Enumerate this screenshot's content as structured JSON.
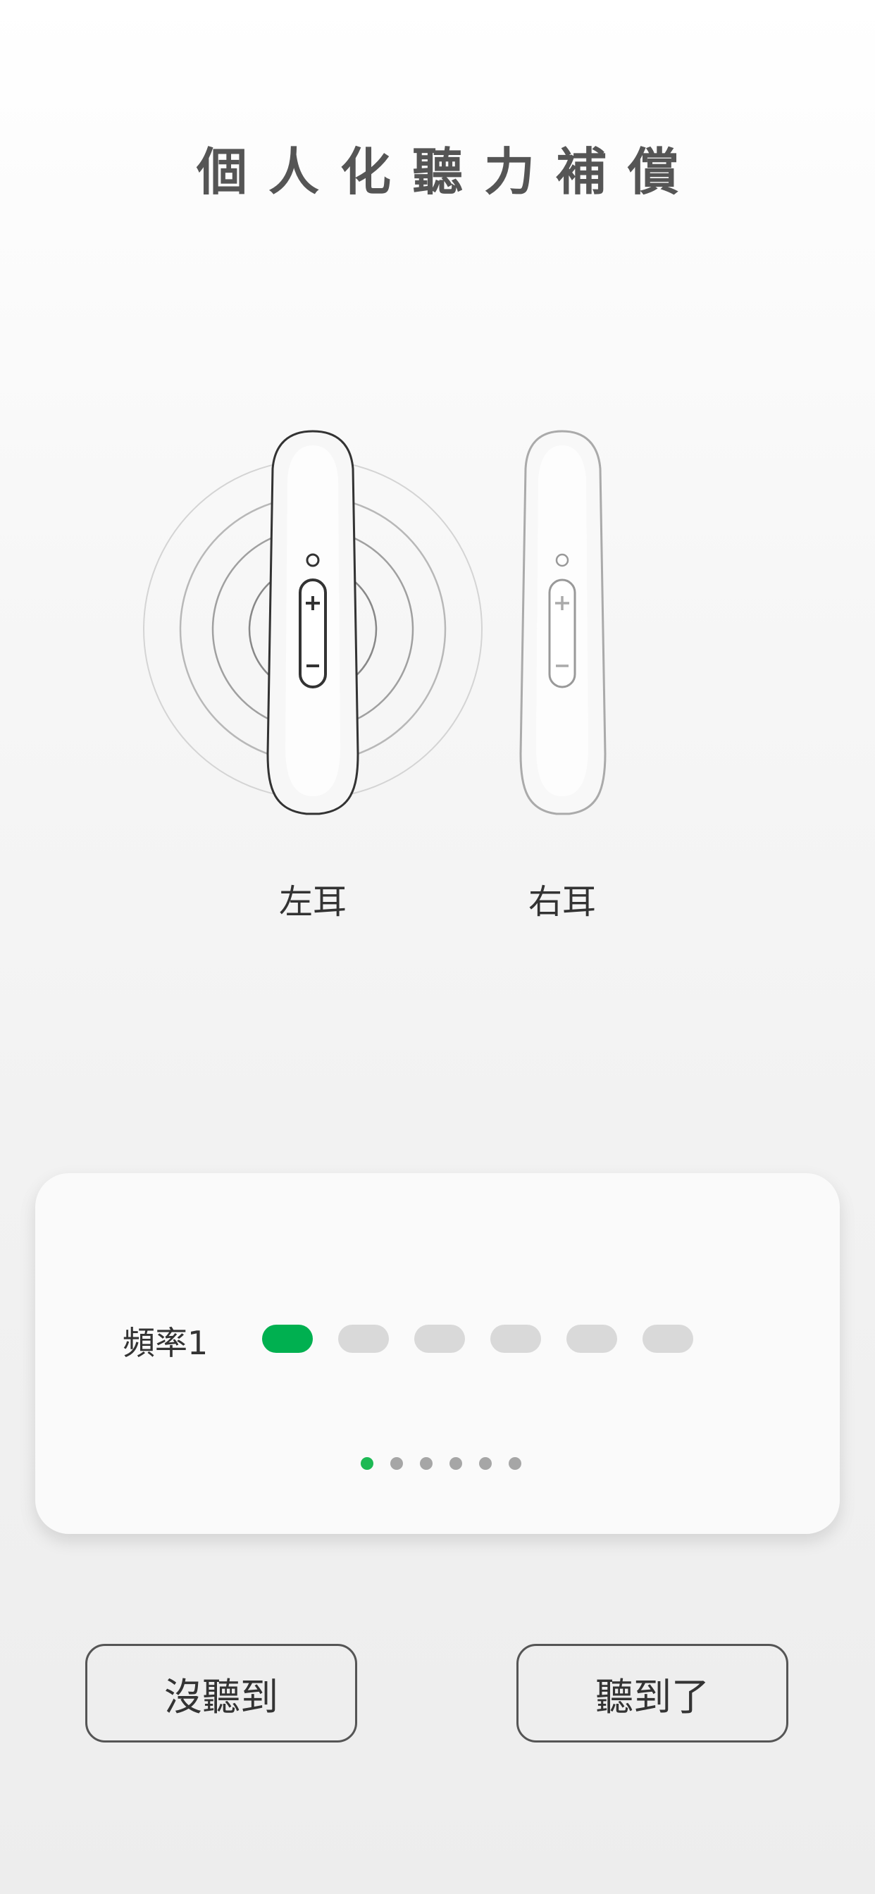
{
  "header": {
    "title": "個人化聽力補償"
  },
  "ears": {
    "left_label": "左耳",
    "right_label": "右耳",
    "active": "left"
  },
  "test_card": {
    "frequency_label": "頻率1",
    "level_steps": 6,
    "active_step": 1,
    "page_count": 6,
    "active_page": 1
  },
  "actions": {
    "not_heard_label": "沒聽到",
    "heard_label": "聽到了"
  },
  "colors": {
    "accent": "#00b050",
    "inactive_pill": "#d9d9d9",
    "inactive_dot": "#a6a6a6"
  }
}
